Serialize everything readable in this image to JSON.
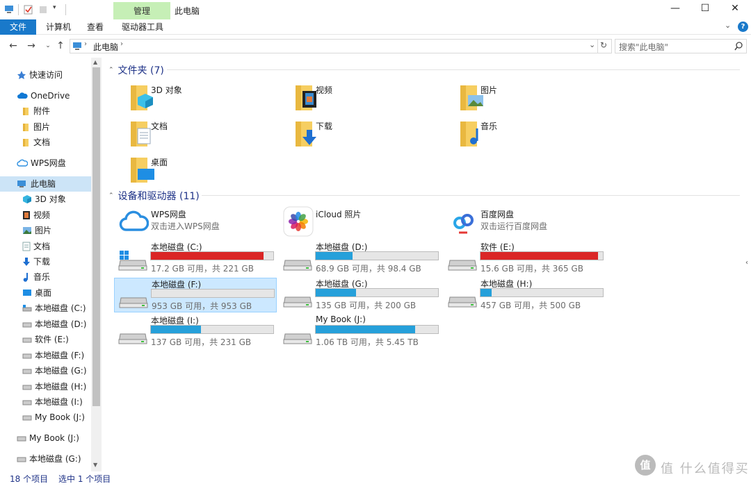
{
  "window": {
    "title": "此电脑",
    "context_tab_group": "管理",
    "min_icon": "minimize-icon",
    "max_icon": "maximize-icon",
    "close_icon": "close-icon"
  },
  "ribbon": {
    "tabs": [
      "文件",
      "计算机",
      "查看",
      "驱动器工具"
    ],
    "help": "?"
  },
  "address": {
    "crumb": "此电脑",
    "search_placeholder": "搜索\"此电脑\""
  },
  "nav": {
    "items": [
      {
        "label": "快速访问",
        "icon": "star-icon"
      },
      {
        "label": "OneDrive",
        "icon": "cloud-icon"
      },
      {
        "label": "附件",
        "icon": "folder-icon"
      },
      {
        "label": "图片",
        "icon": "folder-icon"
      },
      {
        "label": "文档",
        "icon": "folder-icon"
      },
      {
        "label": "WPS网盘",
        "icon": "cloud-outline-icon"
      },
      {
        "label": "此电脑",
        "icon": "computer-icon"
      },
      {
        "label": "3D 对象",
        "icon": "cube-icon"
      },
      {
        "label": "视频",
        "icon": "film-icon"
      },
      {
        "label": "图片",
        "icon": "picture-icon"
      },
      {
        "label": "文档",
        "icon": "document-icon"
      },
      {
        "label": "下载",
        "icon": "download-icon"
      },
      {
        "label": "音乐",
        "icon": "music-icon"
      },
      {
        "label": "桌面",
        "icon": "desktop-icon"
      },
      {
        "label": "本地磁盘 (C:)",
        "icon": "system-drive-icon"
      },
      {
        "label": "本地磁盘 (D:)",
        "icon": "drive-icon"
      },
      {
        "label": "软件 (E:)",
        "icon": "drive-icon"
      },
      {
        "label": "本地磁盘 (F:)",
        "icon": "drive-icon"
      },
      {
        "label": "本地磁盘 (G:)",
        "icon": "drive-icon"
      },
      {
        "label": "本地磁盘 (H:)",
        "icon": "drive-icon"
      },
      {
        "label": "本地磁盘 (I:)",
        "icon": "drive-icon"
      },
      {
        "label": "My Book (J:)",
        "icon": "drive-icon"
      },
      {
        "label": "My Book (J:)",
        "icon": "drive-icon"
      },
      {
        "label": "本地磁盘 (G:)",
        "icon": "drive-icon"
      }
    ]
  },
  "folders_group": {
    "title": "文件夹 (7)",
    "items": [
      {
        "label": "3D 对象",
        "icon": "cube-folder-icon"
      },
      {
        "label": "视频",
        "icon": "video-folder-icon"
      },
      {
        "label": "图片",
        "icon": "pictures-folder-icon"
      },
      {
        "label": "文档",
        "icon": "documents-folder-icon"
      },
      {
        "label": "下载",
        "icon": "downloads-folder-icon"
      },
      {
        "label": "音乐",
        "icon": "music-folder-icon"
      },
      {
        "label": "桌面",
        "icon": "desktop-folder-icon"
      }
    ]
  },
  "devices_group": {
    "title": "设备和驱动器 (11)",
    "services": [
      {
        "name": "WPS网盘",
        "sub": "双击进入WPS网盘",
        "icon": "wps-cloud-icon"
      },
      {
        "name": "iCloud 照片",
        "sub": "",
        "icon": "icloud-photos-icon"
      },
      {
        "name": "百度网盘",
        "sub": "双击运行百度网盘",
        "icon": "baidu-netdisk-icon"
      }
    ],
    "drives": [
      {
        "name": "本地磁盘 (C:)",
        "free": "17.2 GB 可用，共 221 GB",
        "used_fraction": 0.92,
        "color": "#da2626"
      },
      {
        "name": "本地磁盘 (D:)",
        "free": "68.9 GB 可用，共 98.4 GB",
        "used_fraction": 0.3,
        "color": "#26a0da"
      },
      {
        "name": "软件 (E:)",
        "free": "15.6 GB 可用，共 365 GB",
        "used_fraction": 0.96,
        "color": "#da2626"
      },
      {
        "name": "本地磁盘 (F:)",
        "free": "953 GB 可用，共 953 GB",
        "used_fraction": 0.0,
        "color": "#26a0da"
      },
      {
        "name": "本地磁盘 (G:)",
        "free": "135 GB 可用，共 200 GB",
        "used_fraction": 0.33,
        "color": "#26a0da"
      },
      {
        "name": "本地磁盘 (H:)",
        "free": "457 GB 可用，共 500 GB",
        "used_fraction": 0.09,
        "color": "#26a0da"
      },
      {
        "name": "本地磁盘 (I:)",
        "free": "137 GB 可用，共 231 GB",
        "used_fraction": 0.41,
        "color": "#26a0da"
      },
      {
        "name": "My Book (J:)",
        "free": "1.06 TB 可用，共 5.45 TB",
        "used_fraction": 0.81,
        "color": "#26a0da"
      }
    ]
  },
  "status": {
    "count": "18 个项目",
    "selected": "选中 1 个项目"
  },
  "watermark": "值 什么值得买"
}
